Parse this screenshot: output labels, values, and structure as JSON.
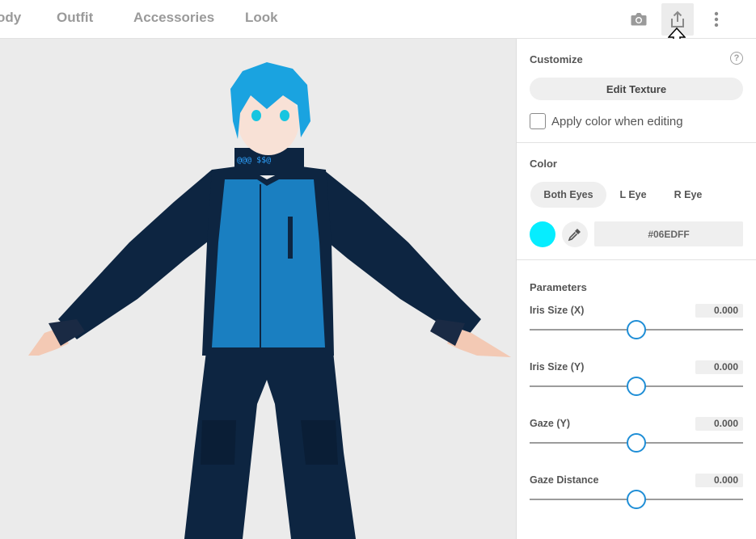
{
  "tabs": [
    "ody",
    "Outfit",
    "Accessories",
    "Look"
  ],
  "toolbar_icons": [
    "camera-icon",
    "share-icon",
    "more-vertical-icon"
  ],
  "customize": {
    "heading": "Customize",
    "edit_texture_label": "Edit Texture",
    "apply_color_label": "Apply color when editing",
    "apply_color_checked": false
  },
  "color": {
    "heading": "Color",
    "eye_tabs": [
      "Both Eyes",
      "L Eye",
      "R Eye"
    ],
    "selected_tab": "Both Eyes",
    "hex": "#06EDFF",
    "swatch_color": "#06EDFF"
  },
  "parameters": {
    "heading": "Parameters",
    "items": [
      {
        "label": "Iris Size (X)",
        "value": "0.000",
        "slider_fraction": 0.5
      },
      {
        "label": "Iris Size (Y)",
        "value": "0.000",
        "slider_fraction": 0.5
      },
      {
        "label": "Gaze (Y)",
        "value": "0.000",
        "slider_fraction": 0.5
      },
      {
        "label": "Gaze Distance",
        "value": "0.000",
        "slider_fraction": 0.5
      }
    ]
  },
  "colors": {
    "accent": "#1F8ED6",
    "hair": "#1AA3E0",
    "jacket_blue": "#1A7FC1",
    "jacket_navy": "#0D2541"
  }
}
